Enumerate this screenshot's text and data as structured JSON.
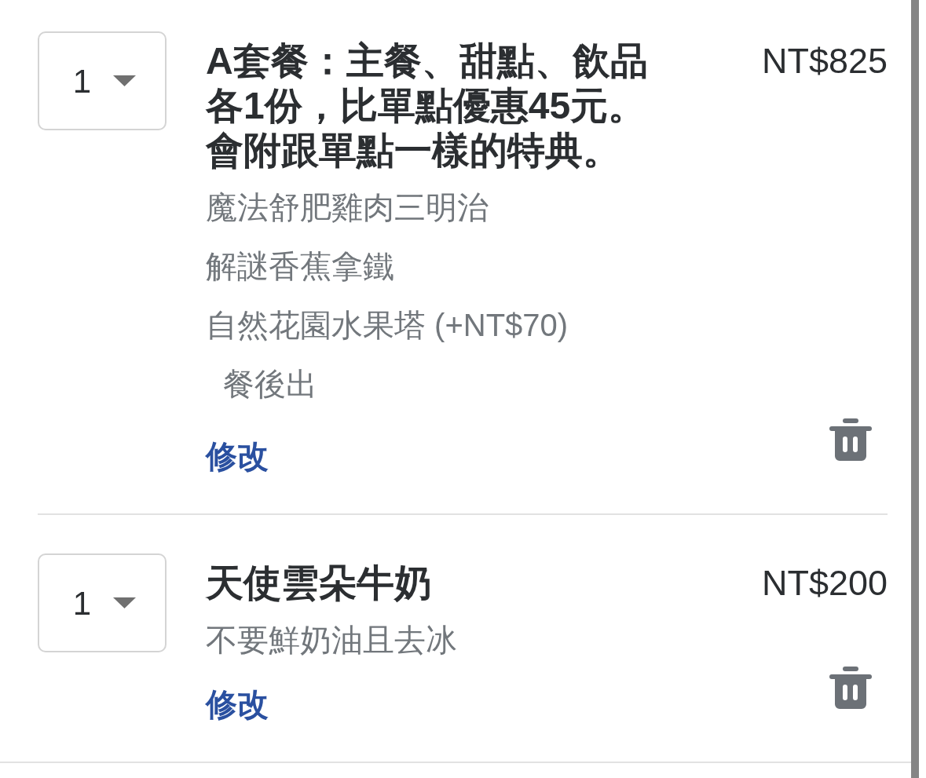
{
  "cart_items": [
    {
      "quantity": "1",
      "title": "A套餐：主餐、甜點、飲品各1份，比單點優惠45元。會附跟單點一樣的特典。",
      "price": "NT$825",
      "options": [
        {
          "text": "魔法舒肥雞肉三明治"
        },
        {
          "text": "解謎香蕉拿鐵"
        },
        {
          "text": "自然花園水果塔 (+NT$70)",
          "children": [
            {
              "text": "餐後出"
            }
          ]
        }
      ],
      "edit_link": "修改"
    },
    {
      "quantity": "1",
      "title": "天使雲朵牛奶",
      "price": "NT$200",
      "options": [
        {
          "text": "不要鮮奶油且去冰"
        }
      ],
      "edit_link": "修改"
    }
  ]
}
